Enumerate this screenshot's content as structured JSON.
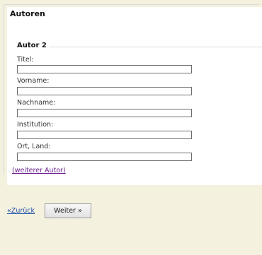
{
  "section_title": "Autoren",
  "author_heading": "Autor 2",
  "fields": [
    {
      "label": "Titel:",
      "value": ""
    },
    {
      "label": "Vorname:",
      "value": ""
    },
    {
      "label": "Nachname:",
      "value": ""
    },
    {
      "label": "Institution:",
      "value": ""
    },
    {
      "label": "Ort, Land:",
      "value": ""
    }
  ],
  "add_author_link": "(weiterer Autor)",
  "nav": {
    "back_label": "«Zurück",
    "next_label": "Weiter »"
  }
}
